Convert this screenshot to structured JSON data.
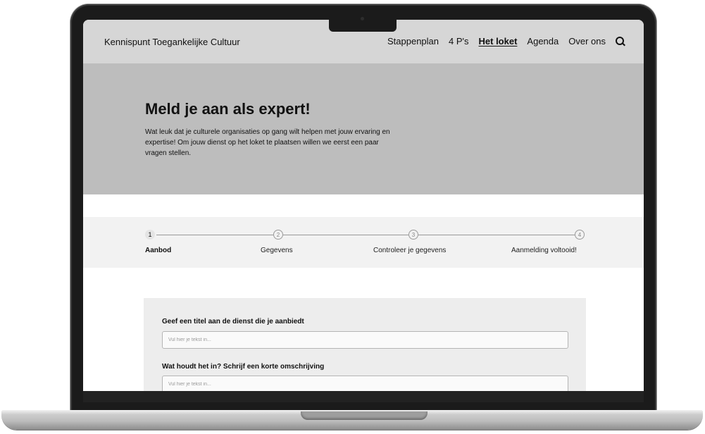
{
  "site": {
    "brand": "Kennispunt Toegankelijke Cultuur"
  },
  "nav": {
    "items": [
      {
        "label": "Stappenplan",
        "active": false
      },
      {
        "label": "4 P's",
        "active": false
      },
      {
        "label": "Het loket",
        "active": true
      },
      {
        "label": "Agenda",
        "active": false
      },
      {
        "label": "Over ons",
        "active": false
      }
    ],
    "search_icon": "search-icon"
  },
  "hero": {
    "title": "Meld je aan als expert!",
    "text": "Wat leuk dat je culturele organisaties op gang wilt helpen met jouw ervaring en expertise! Om jouw dienst op het loket te plaatsen willen we eerst een paar vragen stellen."
  },
  "steps": [
    {
      "number": "1",
      "label": "Aanbod",
      "current": true
    },
    {
      "number": "2",
      "label": "Gegevens",
      "current": false
    },
    {
      "number": "3",
      "label": "Controleer je gegevens",
      "current": false
    },
    {
      "number": "4",
      "label": "Aanmelding voltooid!",
      "current": false
    }
  ],
  "form": {
    "fields": [
      {
        "label": "Geef een titel aan de dienst die je aanbiedt",
        "value": "",
        "placeholder": "Vul hier je tekst in..."
      },
      {
        "label": "Wat houdt het in? Schrijf een korte omschrijving",
        "value": "",
        "placeholder": "Vul hier je tekst in..."
      }
    ]
  },
  "colors": {
    "header_bg": "#d6d6d6",
    "hero_bg": "#bdbdbd",
    "steps_bg": "#f2f2f2",
    "form_bg": "#ededed",
    "frame": "#1b1b1b"
  }
}
